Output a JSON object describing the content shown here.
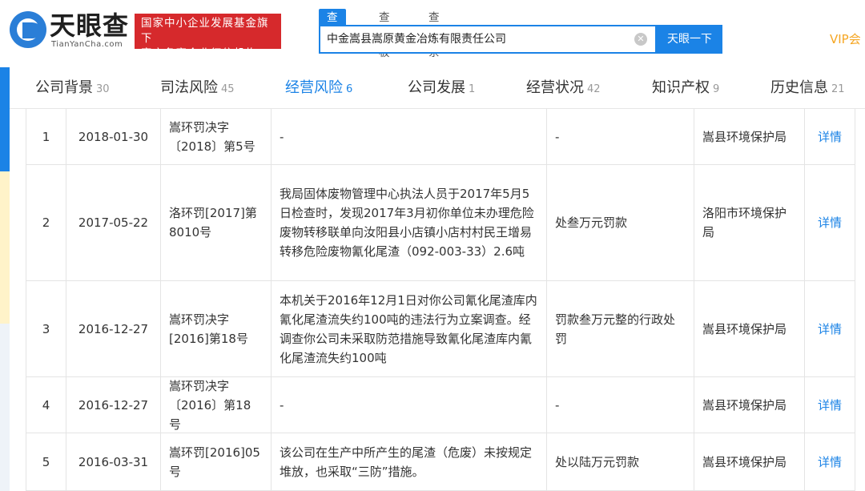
{
  "header": {
    "logo_text": "天眼查",
    "logo_domain": "TianYanCha.com",
    "badge_line1": "国家中小企业发展基金旗下",
    "badge_line2": "官方备案企业征信机构",
    "search_tabs": [
      "查公司",
      "查老板",
      "查关系"
    ],
    "search_value": "中金嵩县嵩原黄金冶炼有限责任公司",
    "search_button": "天眼一下",
    "vip_label": "VIP会"
  },
  "nav": [
    {
      "label": "公司背景",
      "count": "30"
    },
    {
      "label": "司法风险",
      "count": "45"
    },
    {
      "label": "经营风险",
      "count": "6"
    },
    {
      "label": "公司发展",
      "count": "1"
    },
    {
      "label": "经营状况",
      "count": "42"
    },
    {
      "label": "知识产权",
      "count": "9"
    },
    {
      "label": "历史信息",
      "count": "21"
    }
  ],
  "active_nav": "经营风险",
  "rows": [
    {
      "idx": "1",
      "date": "2018-01-30",
      "doc": "嵩环罚决字〔2018〕第5号",
      "content": "-",
      "penalty": "-",
      "dept": "嵩县环境保护局",
      "action": "详情"
    },
    {
      "idx": "2",
      "date": "2017-05-22",
      "doc": "洛环罚[2017]第8010号",
      "content": "我局固体废物管理中心执法人员于2017年5月5日检查时，发现2017年3月初你单位未办理危险废物转移联单向汝阳县小店镇小店村村民王增易转移危险废物氰化尾渣（092-003-33）2.6吨",
      "penalty": "处叁万元罚款",
      "dept": "洛阳市环境保护局",
      "action": "详情"
    },
    {
      "idx": "3",
      "date": "2016-12-27",
      "doc": "嵩环罚决字[2016]第18号",
      "content": "本机关于2016年12月1日对你公司氰化尾渣库内氰化尾渣流失约100吨的违法行为立案调查。经调查你公司未采取防范措施导致氰化尾渣库内氰化尾渣流失约100吨",
      "penalty": "罚款叁万元整的行政处罚",
      "dept": "嵩县环境保护局",
      "action": "详情"
    },
    {
      "idx": "4",
      "date": "2016-12-27",
      "doc": "嵩环罚决字〔2016〕第18号",
      "content": "-",
      "penalty": "-",
      "dept": "嵩县环境保护局",
      "action": "详情"
    },
    {
      "idx": "5",
      "date": "2016-03-31",
      "doc": "嵩环罚[2016]05号",
      "content": "该公司在生产中所产生的尾渣（危废）未按规定堆放，也采取“三防”措施。",
      "penalty": "处以陆万元罚款",
      "dept": "嵩县环境保护局",
      "action": "详情"
    }
  ],
  "colors": {
    "accent": "#1b83e6",
    "badge": "#d6292c",
    "vip": "#f5a623"
  }
}
